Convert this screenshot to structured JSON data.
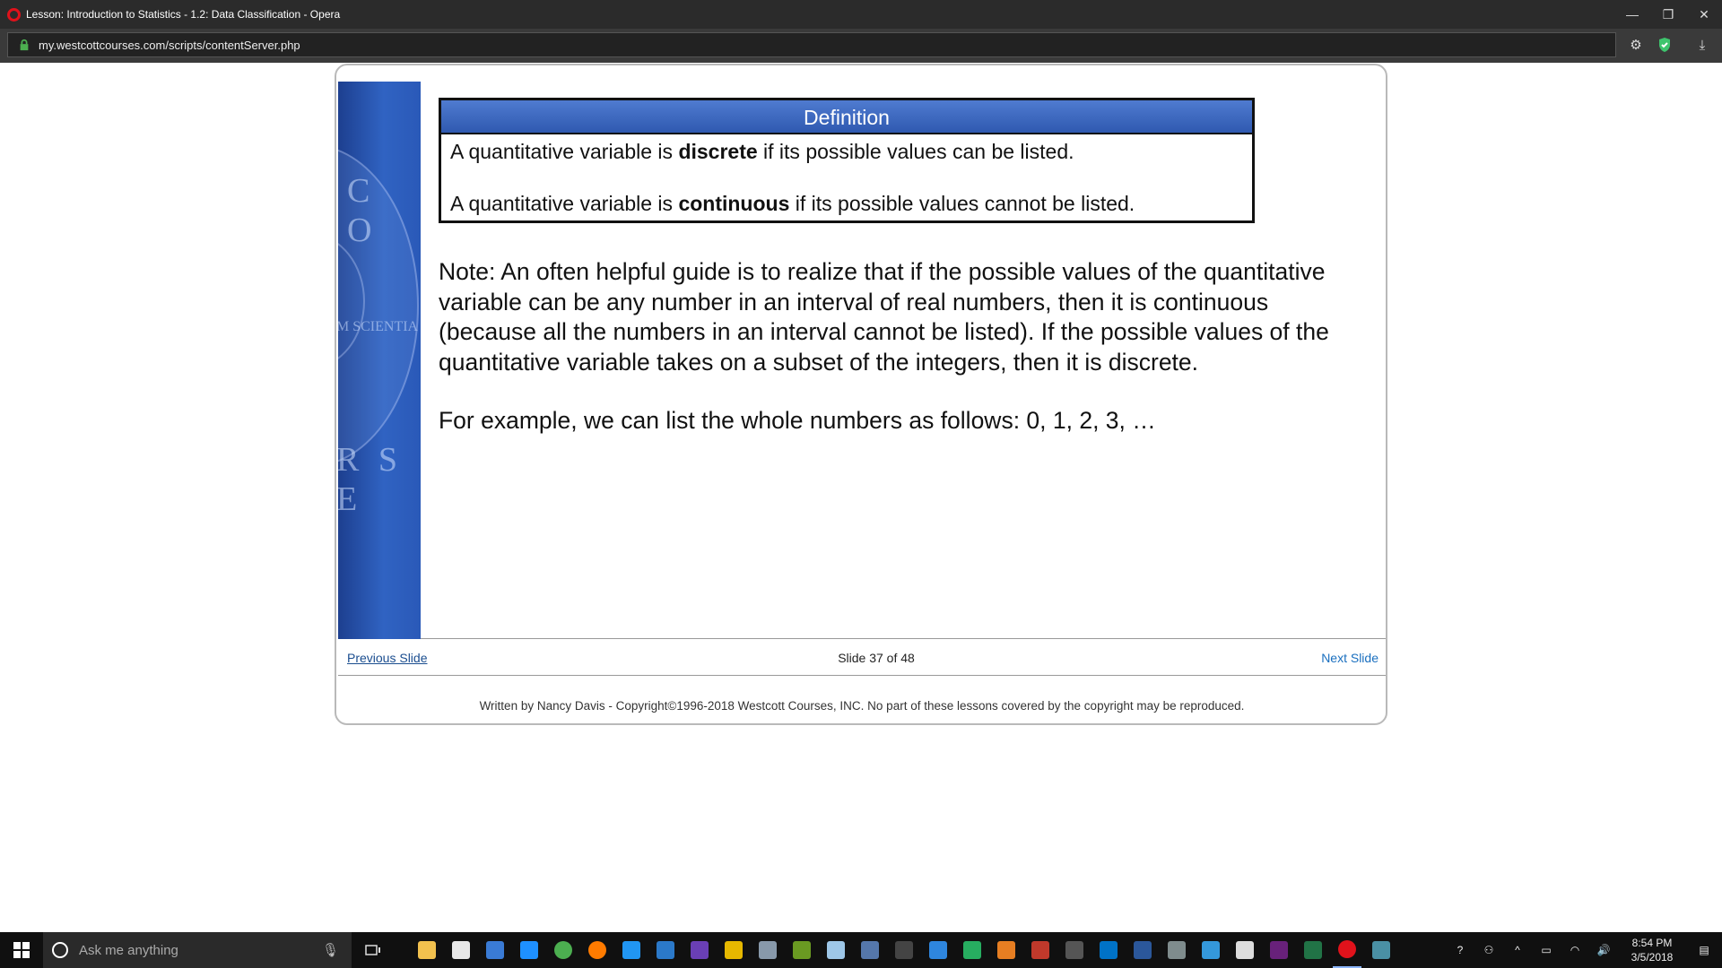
{
  "window": {
    "title": "Lesson: Introduction to Statistics - 1.2: Data Classification - Opera",
    "minimize_glyph": "—",
    "restore_glyph": "❐",
    "close_glyph": "✕"
  },
  "addressbar": {
    "url": "my.westcottcourses.com/scripts/contentServer.php",
    "icons": [
      "padlock-icon",
      "gear-icon",
      "shield-check-icon",
      "download-icon"
    ]
  },
  "slide": {
    "seal_text": {
      "top": "C O",
      "middle": "M SCIENTIA",
      "bottom": "R S E"
    },
    "definition": {
      "heading": "Definition",
      "line1_pre": "A quantitative variable is ",
      "line1_bold": "discrete",
      "line1_post": " if its possible values can be listed.",
      "line2_pre": "A quantitative variable is ",
      "line2_bold": "continuous",
      "line2_post": " if its possible values cannot be listed."
    },
    "note": "Note:  An often helpful guide is to realize that if the possible values of the quantitative variable can be any number in an interval of real numbers, then it is continuous (because all the numbers in an interval cannot be listed).  If the possible values of the quantitative variable takes on a subset of the integers, then it is discrete.",
    "example": "For example, we can list the whole numbers as follows:  0, 1, 2, 3, …"
  },
  "nav": {
    "previous": "Previous Slide",
    "counter": "Slide 37 of 48",
    "next": "Next Slide"
  },
  "footer": "Written by Nancy Davis - Copyright©1996-2018 Westcott Courses, INC. No part of these lessons covered by the copyright may be reproduced.",
  "taskbar": {
    "search_placeholder": "Ask me anything",
    "apps": [
      {
        "name": "file-explorer-icon",
        "color": "#f2c14e"
      },
      {
        "name": "store-icon",
        "color": "#e8e8e8"
      },
      {
        "name": "snipping-tool-icon",
        "color": "#3a7bd5"
      },
      {
        "name": "edge-icon",
        "color": "#1e90ff"
      },
      {
        "name": "chrome-icon",
        "color": "#4caf50"
      },
      {
        "name": "firefox-icon",
        "color": "#ff7b00"
      },
      {
        "name": "internet-explorer-icon",
        "color": "#2196f3"
      },
      {
        "name": "powershell-icon",
        "color": "#2b79c9"
      },
      {
        "name": "dp-app-icon",
        "color": "#6a3fb5"
      },
      {
        "name": "star-app-icon",
        "color": "#e6b800"
      },
      {
        "name": "app-icon-10",
        "color": "#8899aa"
      },
      {
        "name": "lambda-app-icon",
        "color": "#6a9a22"
      },
      {
        "name": "app-icon-12",
        "color": "#9ec7e8"
      },
      {
        "name": "app-icon-13",
        "color": "#5577aa"
      },
      {
        "name": "calculator-icon",
        "color": "#444444"
      },
      {
        "name": "app-icon-15",
        "color": "#2e86de"
      },
      {
        "name": "camtasia-icon",
        "color": "#27ae60"
      },
      {
        "name": "app-icon-17",
        "color": "#e67e22"
      },
      {
        "name": "filezilla-icon",
        "color": "#c0392b"
      },
      {
        "name": "app-icon-19",
        "color": "#555555"
      },
      {
        "name": "outlook-icon",
        "color": "#0072c6"
      },
      {
        "name": "word-icon",
        "color": "#2b579a"
      },
      {
        "name": "app-icon-22",
        "color": "#7f8c8d"
      },
      {
        "name": "app-icon-23",
        "color": "#3498db"
      },
      {
        "name": "mail-icon",
        "color": "#dddddd"
      },
      {
        "name": "visual-studio-icon",
        "color": "#68217a"
      },
      {
        "name": "excel-icon",
        "color": "#217346"
      },
      {
        "name": "opera-icon",
        "color": "#e0121b"
      },
      {
        "name": "app-icon-28",
        "color": "#4a90a4"
      }
    ],
    "tray": {
      "up_arrow": "^",
      "clock_time": "8:54 PM",
      "clock_date": "3/5/2018"
    }
  }
}
